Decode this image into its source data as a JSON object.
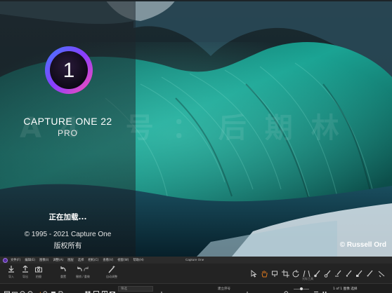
{
  "splash": {
    "app_title": "CAPTURE ONE 22",
    "edition": "PRO",
    "loading_text": "正在加载...",
    "copyright": "© 1995 - 2021 Capture One",
    "rights": "版权所有",
    "photo_credit": "© Russell Ord",
    "watermark": "A4 号：后期林",
    "logo_numeral": "1"
  },
  "menubar": {
    "items": [
      "文件(F)",
      "编辑(E)",
      "图像(I)",
      "调整(A)",
      "图层",
      "选择",
      "相机(C)",
      "查看(V)",
      "视窗(W)",
      "帮助(H)"
    ],
    "window_title": "Capture One"
  },
  "toolbar": {
    "import_label": "导入",
    "export_label": "导出",
    "capture_label": "拍摄",
    "reset_label": "重置",
    "undo_redo_label": "撤销 / 重做",
    "auto_adjust_label": "自动调整",
    "tools_label": "光标工具"
  },
  "bottombar": {
    "filter_placeholder": "筛选",
    "sort_label": "建立序号",
    "image_count": "1 of 1 图像 选择"
  },
  "colors": {
    "accent": "#7a4fd0",
    "orange": "#e07a1e",
    "panel": "#232323"
  }
}
